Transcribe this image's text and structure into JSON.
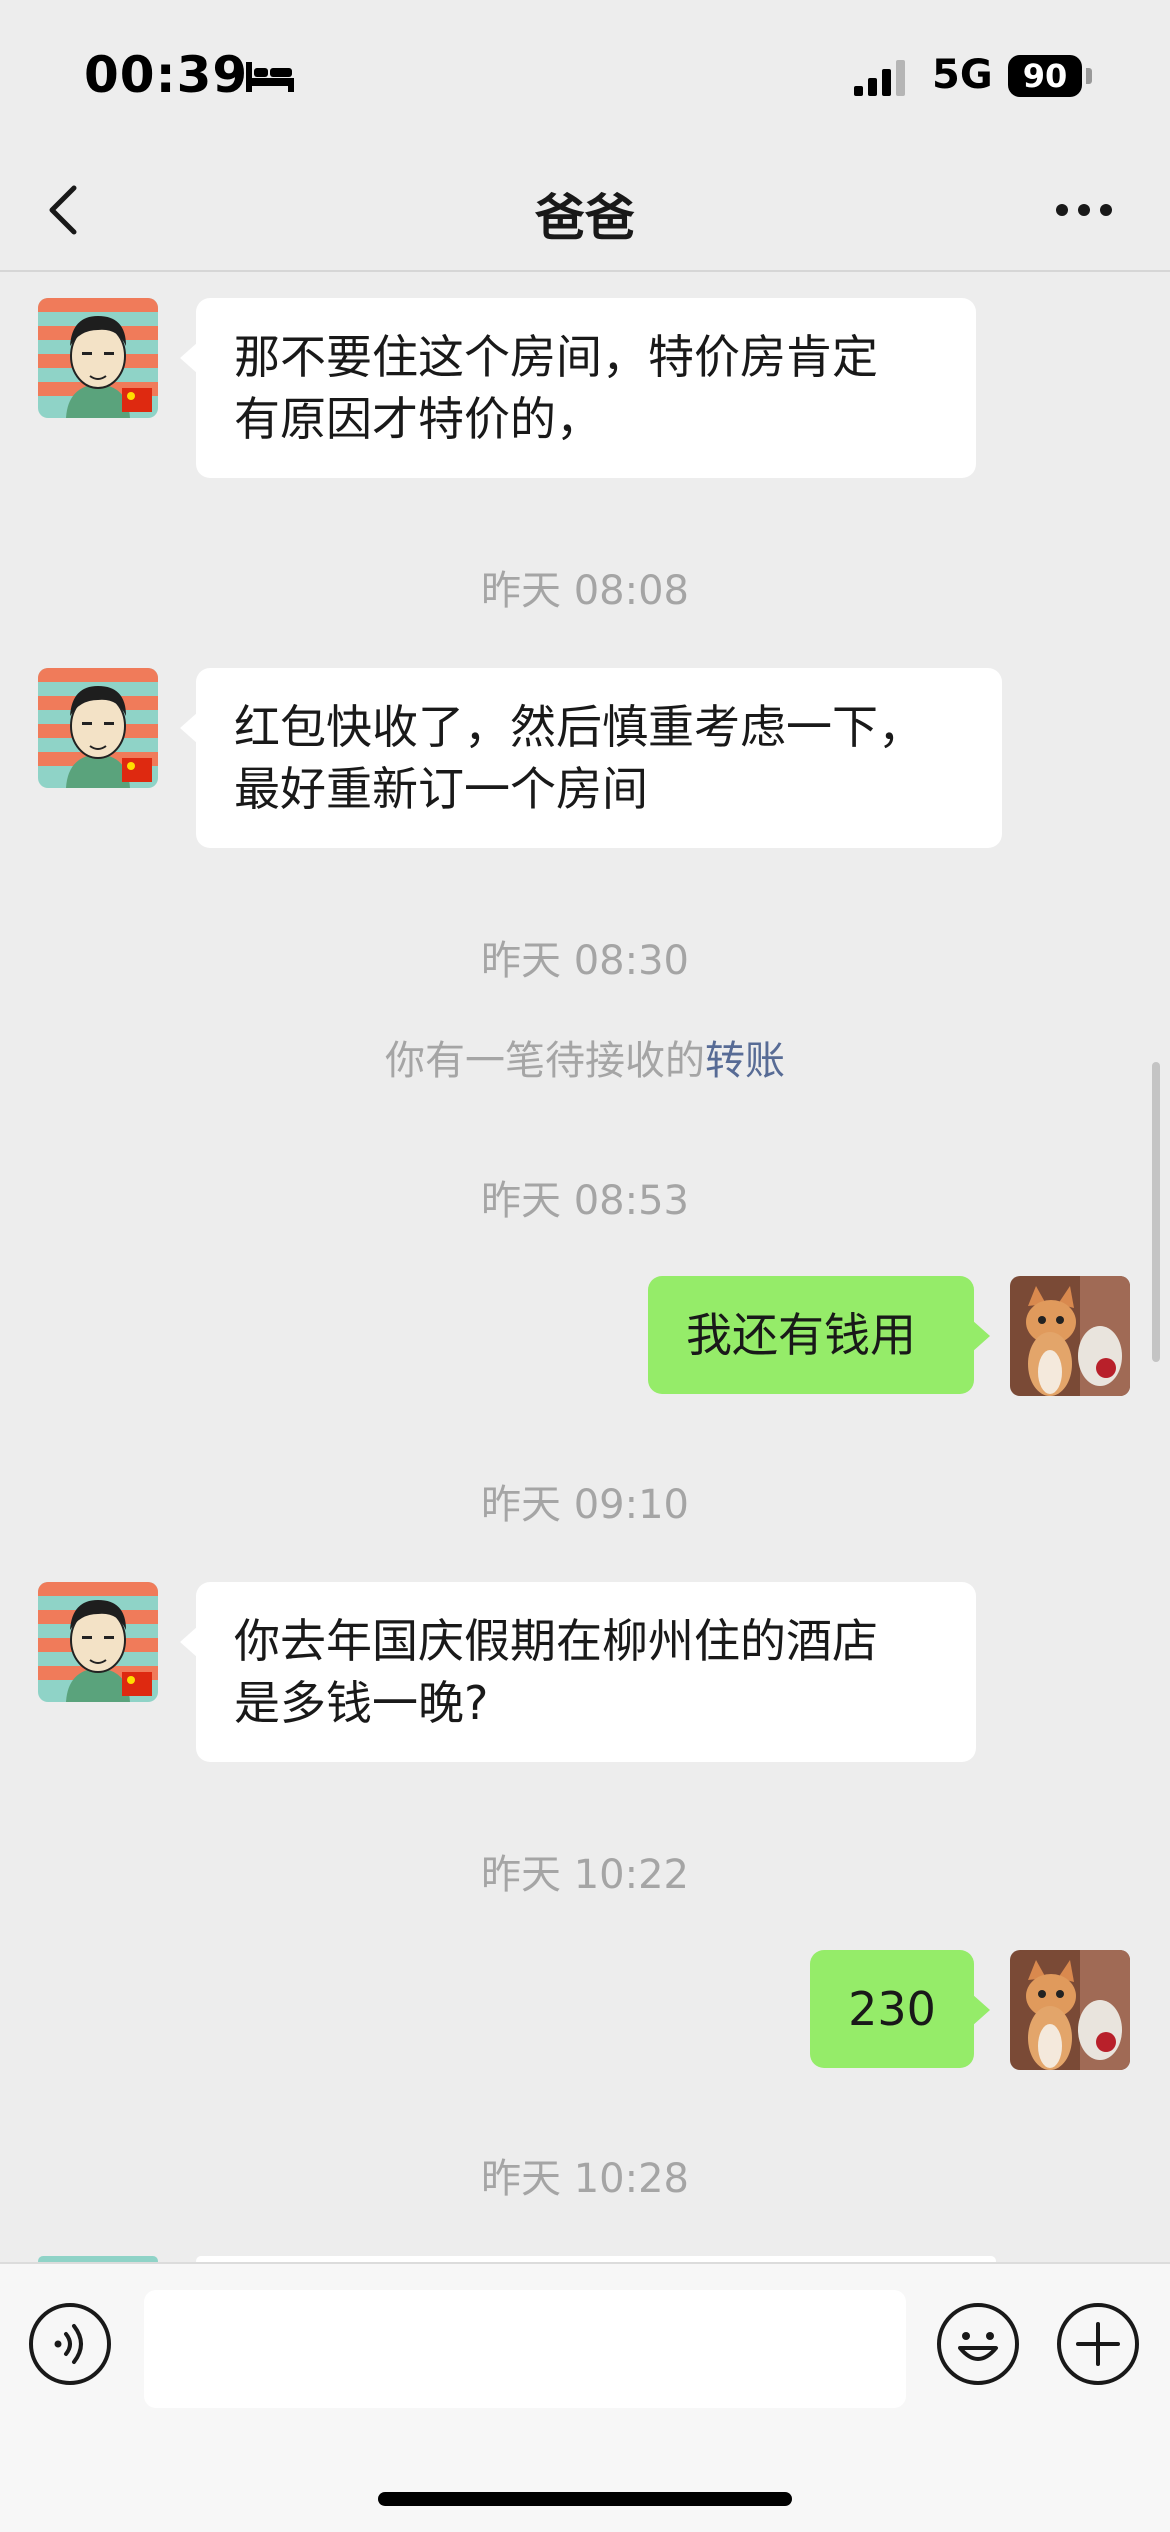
{
  "status_bar": {
    "time": "00:39",
    "network": "5G",
    "battery": "90"
  },
  "nav": {
    "title": "爸爸"
  },
  "messages": [
    {
      "side": "in",
      "text": "那不要住这个房间，特价房肯定\n有原因才特价的，"
    },
    {
      "type": "time",
      "text": "昨天 08:08"
    },
    {
      "side": "in",
      "text": "红包快收了，然后慎重考虑一下，\n最好重新订一个房间"
    },
    {
      "type": "time",
      "text": "昨天 08:30"
    },
    {
      "type": "system",
      "text": "你有一笔待接收的",
      "link": "转账"
    },
    {
      "type": "time",
      "text": "昨天 08:53"
    },
    {
      "side": "out",
      "text": "我还有钱用"
    },
    {
      "type": "time",
      "text": "昨天 09:10"
    },
    {
      "side": "in",
      "text": "你去年国庆假期在柳州住的酒店\n是多钱一晚?"
    },
    {
      "type": "time",
      "text": "昨天 10:22"
    },
    {
      "side": "out",
      "text": "230"
    },
    {
      "type": "time",
      "text": "昨天 10:28"
    }
  ],
  "input": {
    "value": ""
  },
  "icons": {
    "back": "chevron-left-icon",
    "more": "more-dots-icon",
    "voice": "voice-icon",
    "emoji": "emoji-icon",
    "plus": "plus-icon"
  },
  "colors": {
    "background": "#ededed",
    "incoming_bubble": "#ffffff",
    "outgoing_bubble": "#95ec69",
    "timestamp": "#a5a5a5",
    "link": "#576b95"
  }
}
